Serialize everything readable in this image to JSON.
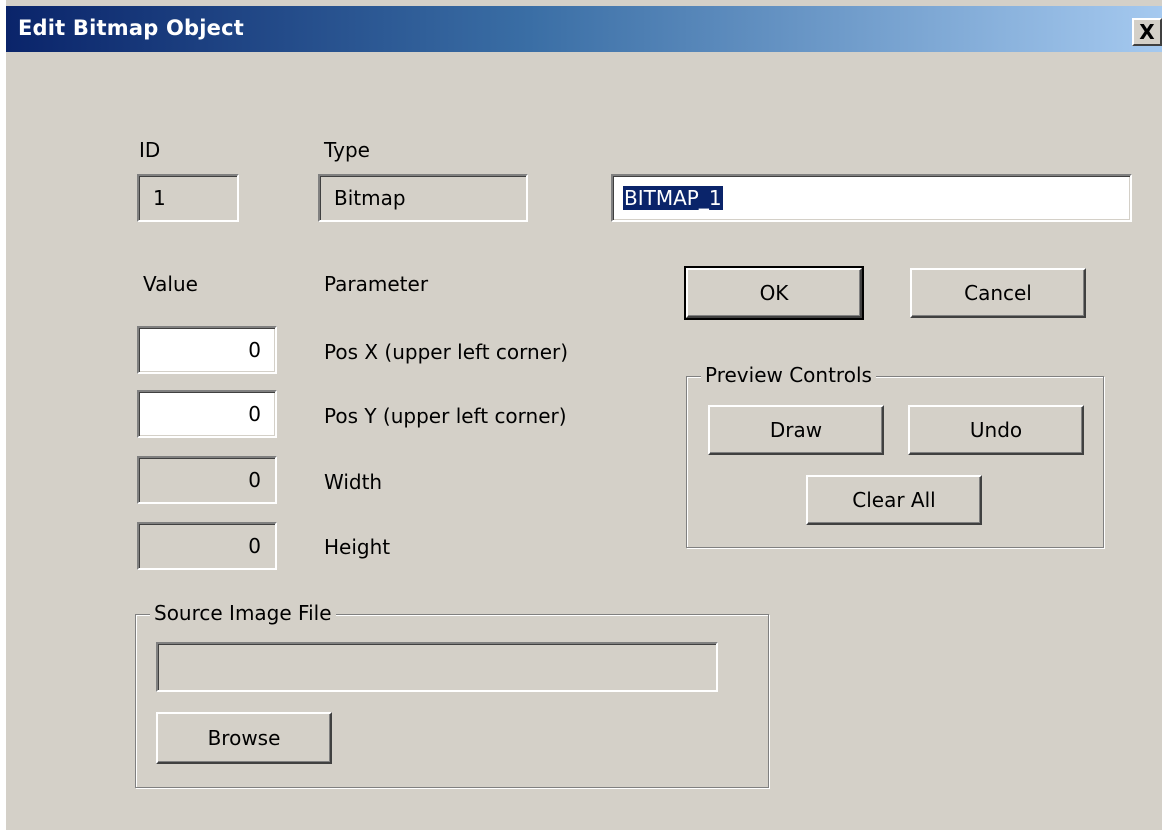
{
  "window": {
    "title": "Edit Bitmap Object",
    "close_label": "X"
  },
  "header_fields": {
    "id_label": "ID",
    "id_value": "1",
    "type_label": "Type",
    "type_value": "Bitmap",
    "name_value": "BITMAP_1"
  },
  "params": {
    "value_header": "Value",
    "parameter_header": "Parameter",
    "rows": [
      {
        "value": "0",
        "label": "Pos X (upper left corner)",
        "editable": true
      },
      {
        "value": "0",
        "label": "Pos Y (upper left corner)",
        "editable": true
      },
      {
        "value": "0",
        "label": "Width",
        "editable": false
      },
      {
        "value": "0",
        "label": "Height",
        "editable": false
      }
    ]
  },
  "buttons": {
    "ok": "OK",
    "cancel": "Cancel"
  },
  "preview": {
    "title": "Preview Controls",
    "draw": "Draw",
    "undo": "Undo",
    "clear_all": "Clear All"
  },
  "source": {
    "title": "Source Image File",
    "path_value": "",
    "browse": "Browse"
  },
  "colors": {
    "face": "#d4d0c8",
    "title_start": "#0a246a",
    "title_end": "#a6caf0",
    "selection": "#0a246a"
  }
}
